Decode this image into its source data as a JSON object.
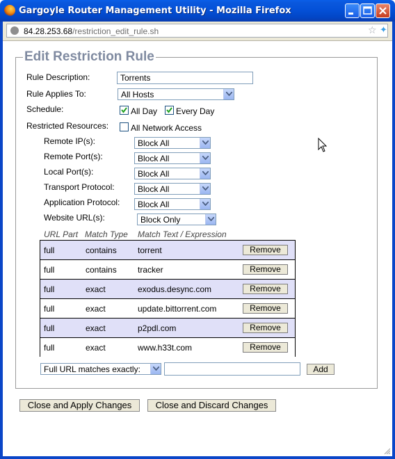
{
  "window": {
    "title": "Gargoyle Router Management Utility - Mozilla Firefox",
    "url_host": "84.28.253.68",
    "url_path": "/restriction_edit_rule.sh"
  },
  "form": {
    "legend": "Edit Restriction Rule",
    "rule_description_label": "Rule Description:",
    "rule_description_value": "Torrents",
    "applies_to_label": "Rule Applies To:",
    "applies_to_value": "All Hosts",
    "schedule_label": "Schedule:",
    "all_day_label": "All Day",
    "all_day_checked": true,
    "every_day_label": "Every Day",
    "every_day_checked": true,
    "restricted_resources_label": "Restricted Resources:",
    "all_network_access_label": "All Network Access",
    "all_network_access_checked": false,
    "resources": [
      {
        "label": "Remote IP(s):",
        "value": "Block All"
      },
      {
        "label": "Remote Port(s):",
        "value": "Block All"
      },
      {
        "label": "Local Port(s):",
        "value": "Block All"
      },
      {
        "label": "Transport Protocol:",
        "value": "Block All"
      },
      {
        "label": "Application Protocol:",
        "value": "Block All"
      },
      {
        "label": "Website URL(s):",
        "value": "Block Only"
      }
    ]
  },
  "url_table": {
    "headers": [
      "URL Part",
      "Match Type",
      "Match Text / Expression"
    ],
    "rows": [
      {
        "part": "full",
        "type": "contains",
        "text": "torrent",
        "action": "Remove"
      },
      {
        "part": "full",
        "type": "contains",
        "text": "tracker",
        "action": "Remove"
      },
      {
        "part": "full",
        "type": "exact",
        "text": "exodus.desync.com",
        "action": "Remove"
      },
      {
        "part": "full",
        "type": "exact",
        "text": "update.bittorrent.com",
        "action": "Remove"
      },
      {
        "part": "full",
        "type": "exact",
        "text": "p2pdl.com",
        "action": "Remove"
      },
      {
        "part": "full",
        "type": "exact",
        "text": "www.h33t.com",
        "action": "Remove"
      }
    ]
  },
  "add_row": {
    "match_select_value": "Full URL matches exactly:",
    "input_value": "",
    "add_label": "Add"
  },
  "buttons": {
    "apply": "Close and Apply Changes",
    "discard": "Close and Discard Changes"
  },
  "colors": {
    "titlebar": "#0451d8",
    "legend": "#7f8aa0",
    "row_highlight": "#e0e0f8"
  }
}
